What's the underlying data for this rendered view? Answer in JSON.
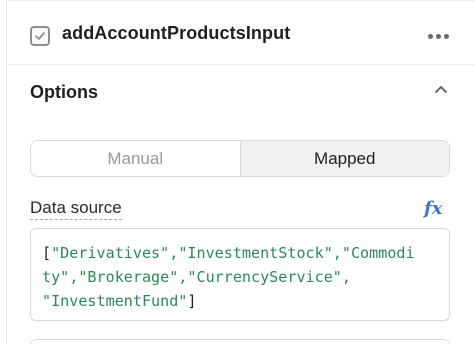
{
  "component": {
    "name": "addAccountProductsInput",
    "type_icon": "checkbox-icon",
    "menu_icon": "more-icon"
  },
  "options": {
    "title": "Options",
    "collapse_icon": "chevron-up-icon"
  },
  "mode_toggle": {
    "options": [
      "Manual",
      "Mapped"
    ],
    "selected": "Mapped"
  },
  "data_source": {
    "label": "Data source",
    "fx_label": "fx",
    "code_lines": [
      {
        "open": "[",
        "text": "\"Derivatives\",\"InvestmentStock\",\"Commodi",
        "close": ""
      },
      {
        "open": "",
        "text": "ty\",\"Brokerage\",\"CurrencyService\",",
        "close": ""
      },
      {
        "open": "",
        "text": "\"InvestmentFund\"",
        "close": "]"
      }
    ]
  },
  "colors": {
    "string_literal": "#2b8a52",
    "fx_accent": "#3d74d6",
    "selected_segment_bg": "#f1f1f1"
  }
}
